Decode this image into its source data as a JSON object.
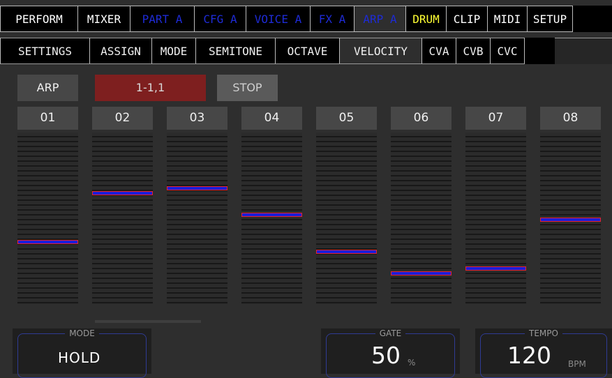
{
  "top_tabs": [
    {
      "label": "PERFORM",
      "color": "#ffffff"
    },
    {
      "label": "MIXER",
      "color": "#ffffff"
    },
    {
      "label": "PART A",
      "color": "#1e2bd6"
    },
    {
      "label": "CFG A",
      "color": "#1e2bd6"
    },
    {
      "label": "VOICE A",
      "color": "#1e2bd6"
    },
    {
      "label": "FX A",
      "color": "#1e2bd6"
    },
    {
      "label": "ARP A",
      "color": "#1e2bd6",
      "selected": true
    },
    {
      "label": "DRUM",
      "color": "#ffff33"
    },
    {
      "label": "CLIP",
      "color": "#ffffff"
    },
    {
      "label": "MIDI",
      "color": "#ffffff"
    },
    {
      "label": "SETUP",
      "color": "#ffffff"
    }
  ],
  "sub_tabs": [
    {
      "label": "SETTINGS"
    },
    {
      "label": "ASSIGN"
    },
    {
      "label": "MODE"
    },
    {
      "label": "SEMITONE"
    },
    {
      "label": "OCTAVE"
    },
    {
      "label": "VELOCITY",
      "selected": true
    },
    {
      "label": "CVA"
    },
    {
      "label": "CVB"
    },
    {
      "label": "CVC"
    }
  ],
  "controls": {
    "arp_label": "ARP",
    "position": "1-1,1",
    "stop_label": "STOP"
  },
  "steps": [
    {
      "label": "01",
      "value": 0.36
    },
    {
      "label": "02",
      "value": 0.65
    },
    {
      "label": "03",
      "value": 0.68
    },
    {
      "label": "04",
      "value": 0.52
    },
    {
      "label": "05",
      "value": 0.3
    },
    {
      "label": "06",
      "value": 0.17
    },
    {
      "label": "07",
      "value": 0.2
    },
    {
      "label": "08",
      "value": 0.49
    }
  ],
  "panels": {
    "mode": {
      "label": "MODE",
      "value": "HOLD"
    },
    "gate": {
      "label": "GATE",
      "value": "50",
      "unit": "%"
    },
    "tempo": {
      "label": "TEMPO",
      "value": "120",
      "unit": "BPM"
    }
  },
  "colors": {
    "tab_default": "#ffffff",
    "tab_part": "#1e2bd6",
    "tab_drum": "#ffff33",
    "position_bg": "#7e1f1f",
    "marker_fill": "#1d1dd8",
    "marker_border": "#e8232a"
  }
}
